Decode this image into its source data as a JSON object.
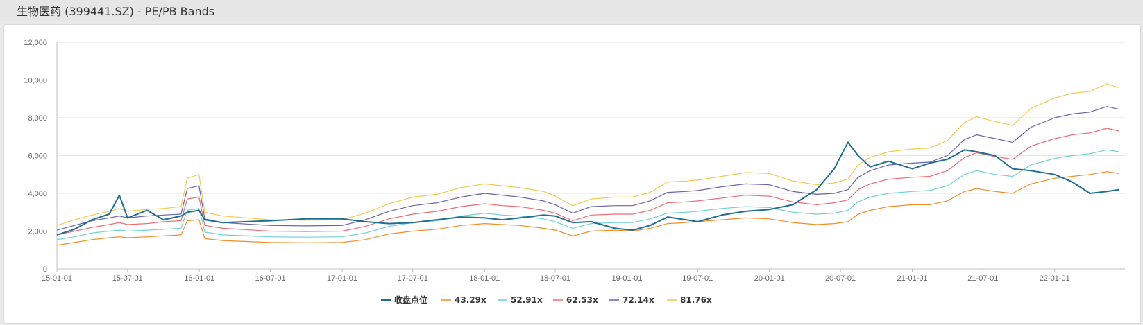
{
  "header": {
    "title": "生物医药 (399441.SZ) - PE/PB Bands"
  },
  "colors": {
    "close": "#1f6e91",
    "b1": "#f28c28",
    "b2": "#6fd1d1",
    "b3": "#f06a74",
    "b4": "#6a64a8",
    "b5": "#f3c94e",
    "grid": "#e6e6e6",
    "axis": "#c0c0c0"
  },
  "chart_data": {
    "type": "line",
    "title": "",
    "xlabel": "",
    "ylabel": "",
    "ylim": [
      0,
      12000
    ],
    "y_ticks": [
      "0",
      "2,000",
      "4,000",
      "6,000",
      "8,000",
      "10,000",
      "12,000"
    ],
    "x_ticks": [
      "15-01-01",
      "15-07-01",
      "16-01-01",
      "16-07-01",
      "17-01-01",
      "17-07-01",
      "18-01-01",
      "18-07-01",
      "19-01-01",
      "19-07-01",
      "20-01-01",
      "20-07-01",
      "21-01-01",
      "21-07-01",
      "22-01-01"
    ],
    "legend_position": "bottom-center",
    "grid": true,
    "x": [
      "2015-01-01",
      "2015-02-15",
      "2015-04-01",
      "2015-05-15",
      "2015-06-10",
      "2015-07-01",
      "2015-08-20",
      "2015-10-01",
      "2015-11-15",
      "2015-12-01",
      "2015-12-31",
      "2016-01-15",
      "2016-03-01",
      "2016-07-01",
      "2016-10-01",
      "2017-01-01",
      "2017-03-01",
      "2017-05-01",
      "2017-07-01",
      "2017-09-01",
      "2017-11-01",
      "2018-01-01",
      "2018-02-15",
      "2018-04-01",
      "2018-06-01",
      "2018-07-01",
      "2018-08-15",
      "2018-10-01",
      "2018-12-01",
      "2019-01-15",
      "2019-03-01",
      "2019-04-15",
      "2019-06-01",
      "2019-07-01",
      "2019-09-01",
      "2019-11-01",
      "2020-01-01",
      "2020-03-01",
      "2020-05-01",
      "2020-06-15",
      "2020-07-20",
      "2020-08-15",
      "2020-09-15",
      "2020-11-01",
      "2021-01-01",
      "2021-02-15",
      "2021-04-01",
      "2021-05-15",
      "2021-06-15",
      "2021-08-01",
      "2021-09-15",
      "2021-11-01",
      "2022-01-01",
      "2022-02-15",
      "2022-04-01",
      "2022-05-15",
      "2022-06-15"
    ],
    "series": [
      {
        "name": "收盘点位",
        "values": [
          1800,
          2100,
          2600,
          2900,
          3900,
          2700,
          3100,
          2600,
          2800,
          3000,
          3100,
          2600,
          2450,
          2550,
          2650,
          2650,
          2500,
          2400,
          2450,
          2600,
          2750,
          2700,
          2600,
          2700,
          2850,
          2800,
          2450,
          2500,
          2150,
          2050,
          2300,
          2750,
          2600,
          2500,
          2850,
          3050,
          3150,
          3400,
          4200,
          5300,
          6700,
          6000,
          5400,
          5700,
          5300,
          5600,
          5800,
          6300,
          6200,
          6000,
          5300,
          5200,
          5000,
          4600,
          4000,
          4100,
          4200
        ]
      },
      {
        "name": "43.29x",
        "values": [
          1250,
          1400,
          1550,
          1650,
          1700,
          1650,
          1700,
          1750,
          1800,
          2550,
          2600,
          1600,
          1500,
          1400,
          1380,
          1400,
          1550,
          1850,
          2000,
          2100,
          2300,
          2400,
          2350,
          2300,
          2150,
          2050,
          1750,
          2000,
          2050,
          2000,
          2150,
          2400,
          2450,
          2500,
          2600,
          2700,
          2650,
          2450,
          2350,
          2400,
          2500,
          2900,
          3100,
          3300,
          3400,
          3400,
          3600,
          4100,
          4250,
          4100,
          4000,
          4500,
          4800,
          4900,
          5000,
          5150,
          5050
        ]
      },
      {
        "name": "52.91x",
        "values": [
          1550,
          1700,
          1900,
          2000,
          2050,
          2000,
          2050,
          2100,
          2150,
          3100,
          3200,
          1950,
          1800,
          1700,
          1680,
          1700,
          1900,
          2250,
          2450,
          2550,
          2800,
          2950,
          2850,
          2800,
          2650,
          2500,
          2150,
          2400,
          2450,
          2450,
          2650,
          2950,
          3000,
          3050,
          3200,
          3300,
          3250,
          3000,
          2900,
          2950,
          3100,
          3550,
          3800,
          4000,
          4100,
          4150,
          4400,
          5000,
          5200,
          5000,
          4900,
          5500,
          5850,
          6000,
          6100,
          6300,
          6200
        ]
      },
      {
        "name": "62.53x",
        "values": [
          1800,
          2000,
          2200,
          2350,
          2450,
          2350,
          2400,
          2500,
          2550,
          3700,
          3800,
          2300,
          2150,
          2000,
          1980,
          2000,
          2250,
          2650,
          2900,
          3050,
          3300,
          3450,
          3350,
          3300,
          3100,
          2950,
          2550,
          2850,
          2900,
          2900,
          3100,
          3500,
          3550,
          3600,
          3750,
          3900,
          3850,
          3550,
          3400,
          3500,
          3650,
          4200,
          4500,
          4750,
          4850,
          4900,
          5200,
          5900,
          6150,
          5950,
          5800,
          6500,
          6900,
          7100,
          7200,
          7450,
          7300
        ]
      },
      {
        "name": "72.14x",
        "values": [
          2050,
          2300,
          2550,
          2700,
          2800,
          2700,
          2800,
          2850,
          2900,
          4250,
          4400,
          2650,
          2450,
          2300,
          2280,
          2300,
          2600,
          3050,
          3350,
          3500,
          3800,
          4000,
          3900,
          3800,
          3600,
          3400,
          2950,
          3300,
          3350,
          3350,
          3600,
          4050,
          4100,
          4150,
          4350,
          4500,
          4450,
          4100,
          3950,
          4000,
          4200,
          4850,
          5200,
          5500,
          5600,
          5650,
          6000,
          6850,
          7100,
          6900,
          6700,
          7500,
          8000,
          8200,
          8300,
          8600,
          8450
        ]
      },
      {
        "name": "81.76x",
        "values": [
          2300,
          2600,
          2850,
          3050,
          3200,
          3050,
          3150,
          3200,
          3300,
          4800,
          5000,
          3000,
          2800,
          2600,
          2580,
          2600,
          2950,
          3450,
          3800,
          3950,
          4300,
          4500,
          4400,
          4300,
          4100,
          3850,
          3350,
          3700,
          3800,
          3800,
          4050,
          4600,
          4650,
          4700,
          4900,
          5100,
          5050,
          4650,
          4450,
          4550,
          4750,
          5500,
          5900,
          6200,
          6350,
          6400,
          6800,
          7750,
          8050,
          7800,
          7600,
          8500,
          9050,
          9300,
          9400,
          9800,
          9600
        ]
      }
    ]
  }
}
